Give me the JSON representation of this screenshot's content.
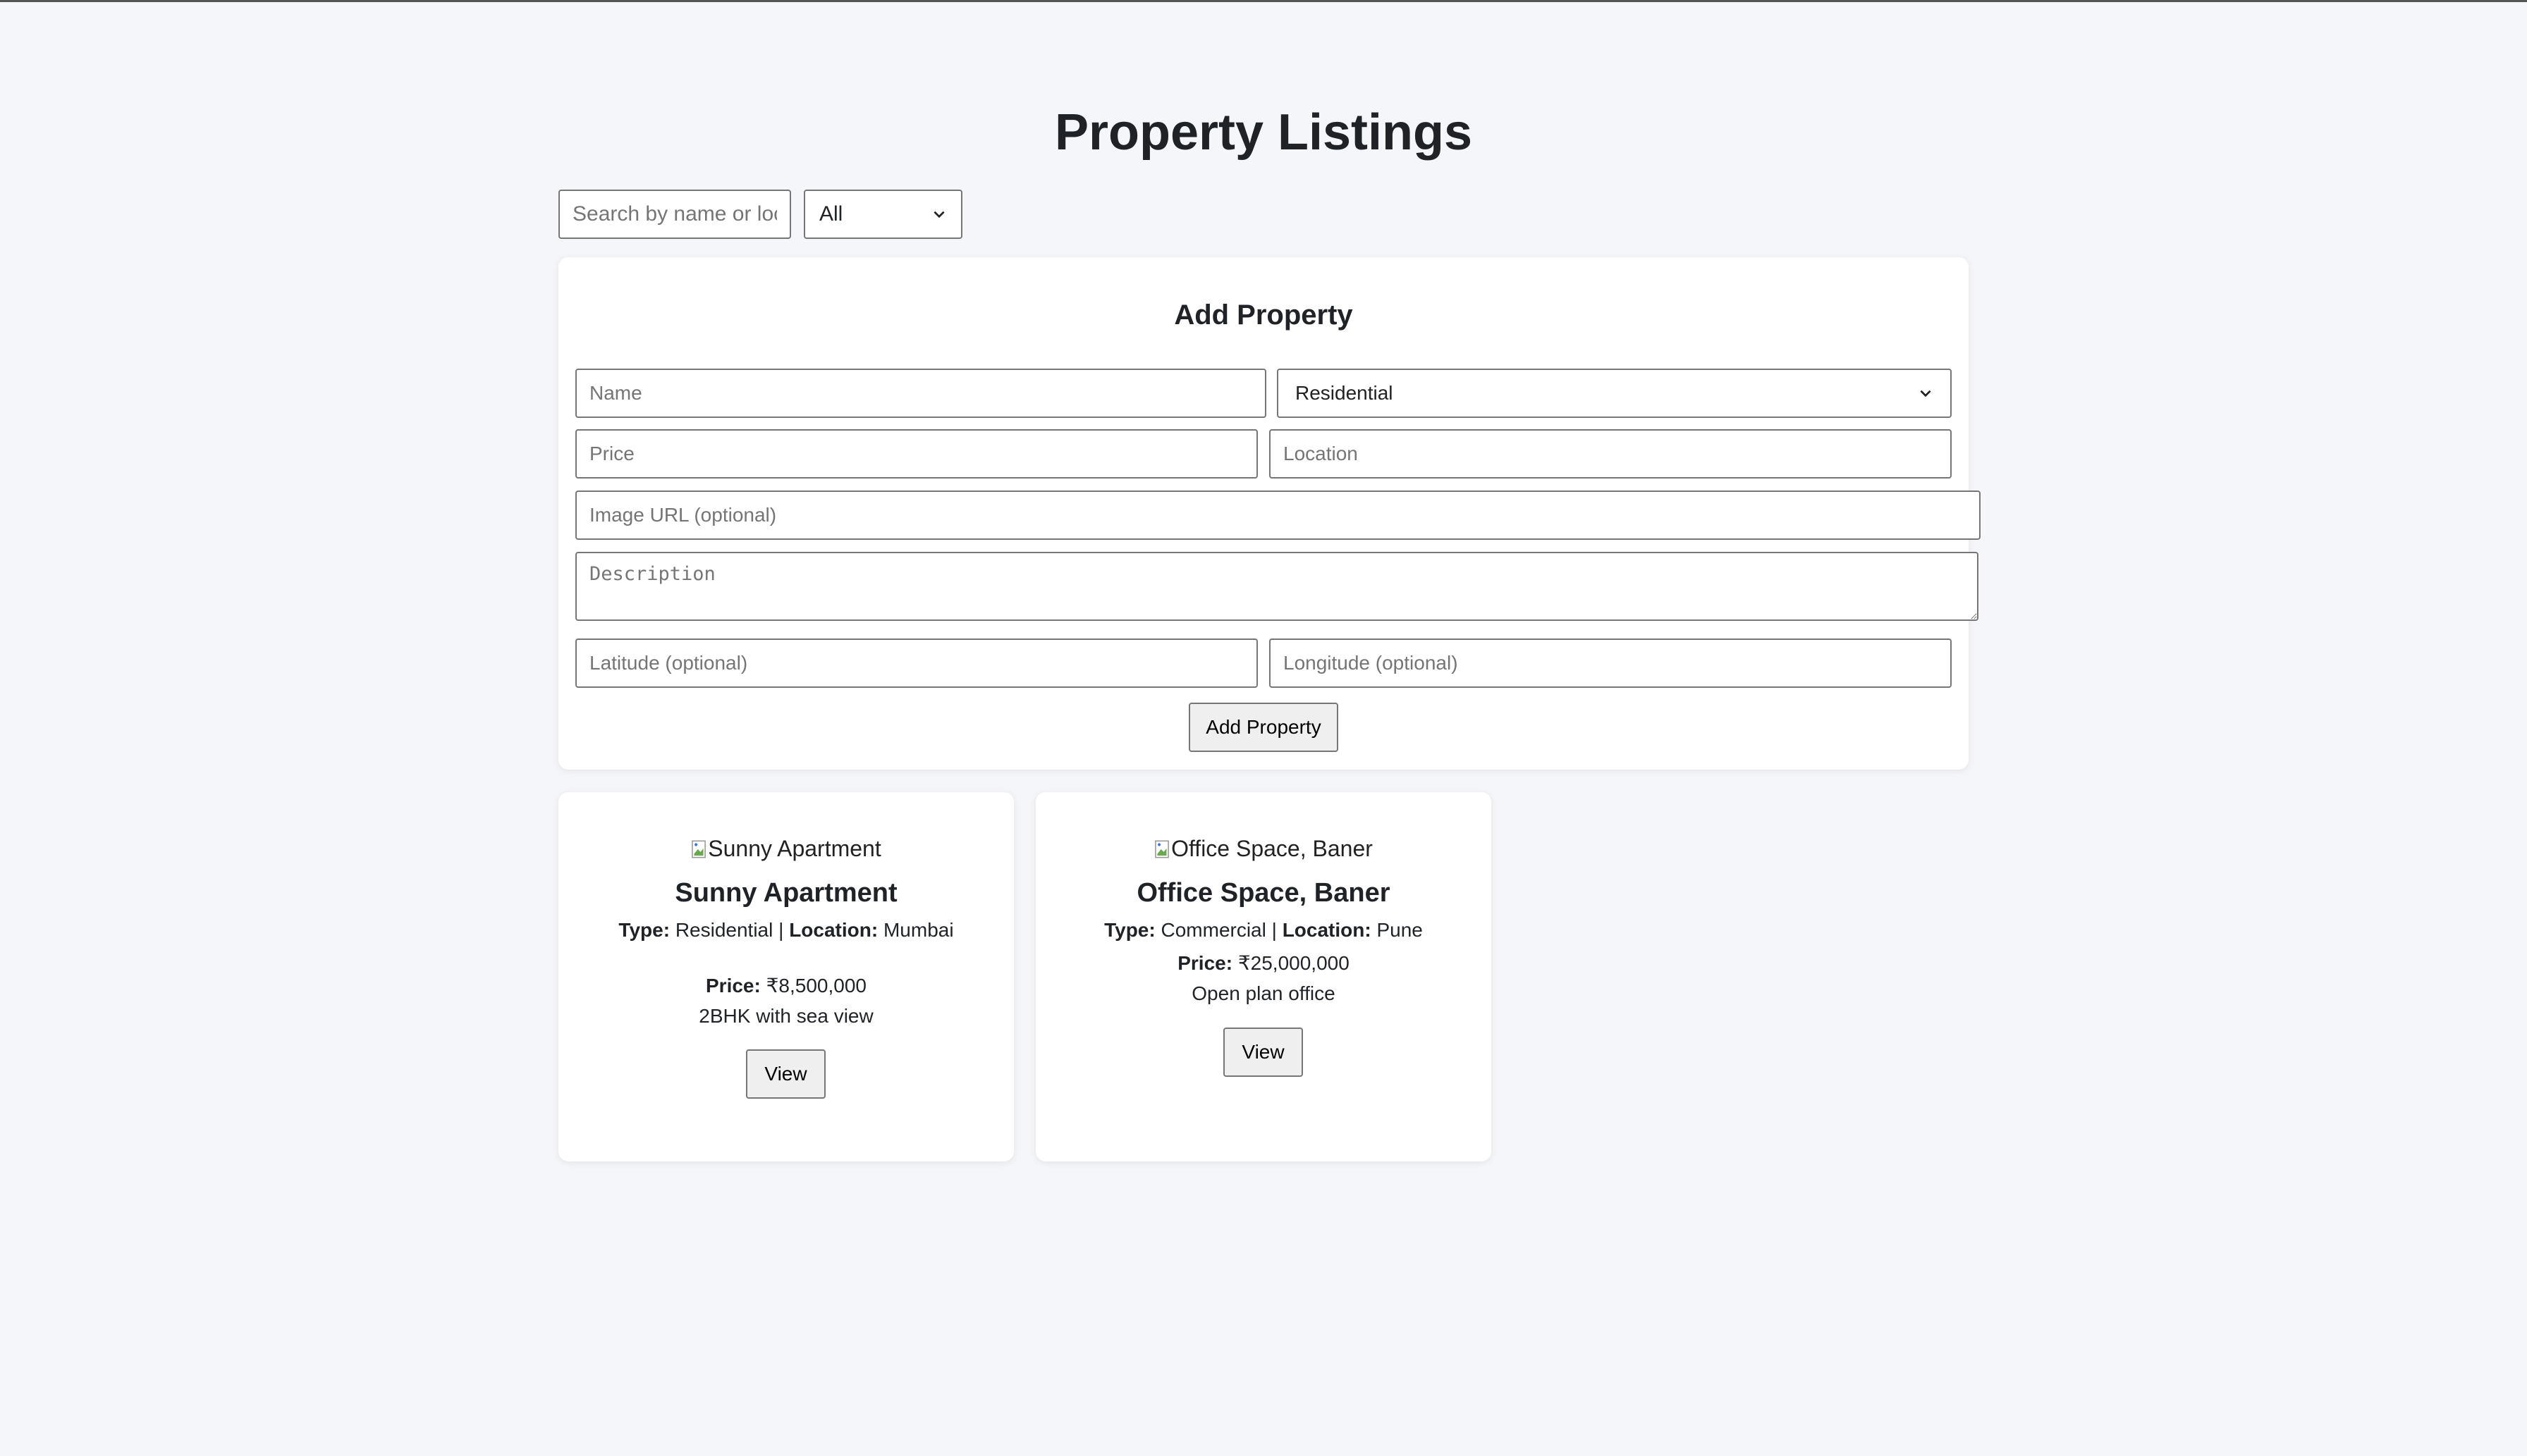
{
  "page": {
    "title": "Property Listings"
  },
  "filters": {
    "search_placeholder": "Search by name or location",
    "type_selected": "All"
  },
  "form": {
    "title": "Add Property",
    "name_placeholder": "Name",
    "type_selected": "Residential",
    "price_placeholder": "Price",
    "location_placeholder": "Location",
    "image_placeholder": "Image URL (optional)",
    "description_placeholder": "Description",
    "latitude_placeholder": "Latitude (optional)",
    "longitude_placeholder": "Longitude (optional)",
    "submit_label": "Add Property"
  },
  "labels": {
    "type": "Type:",
    "location": "Location:",
    "price": "Price:",
    "separator": " | "
  },
  "properties": [
    {
      "image_alt": "Sunny Apartment",
      "name": "Sunny Apartment",
      "type": "Residential",
      "location": "Mumbai",
      "price": "₹8,500,000",
      "description": "2BHK with sea view",
      "view_label": "View"
    },
    {
      "image_alt": "Office Space, Baner",
      "name": "Office Space, Baner",
      "type": "Commercial",
      "location": "Pune",
      "price": "₹25,000,000",
      "description": "Open plan office",
      "view_label": "View"
    }
  ]
}
